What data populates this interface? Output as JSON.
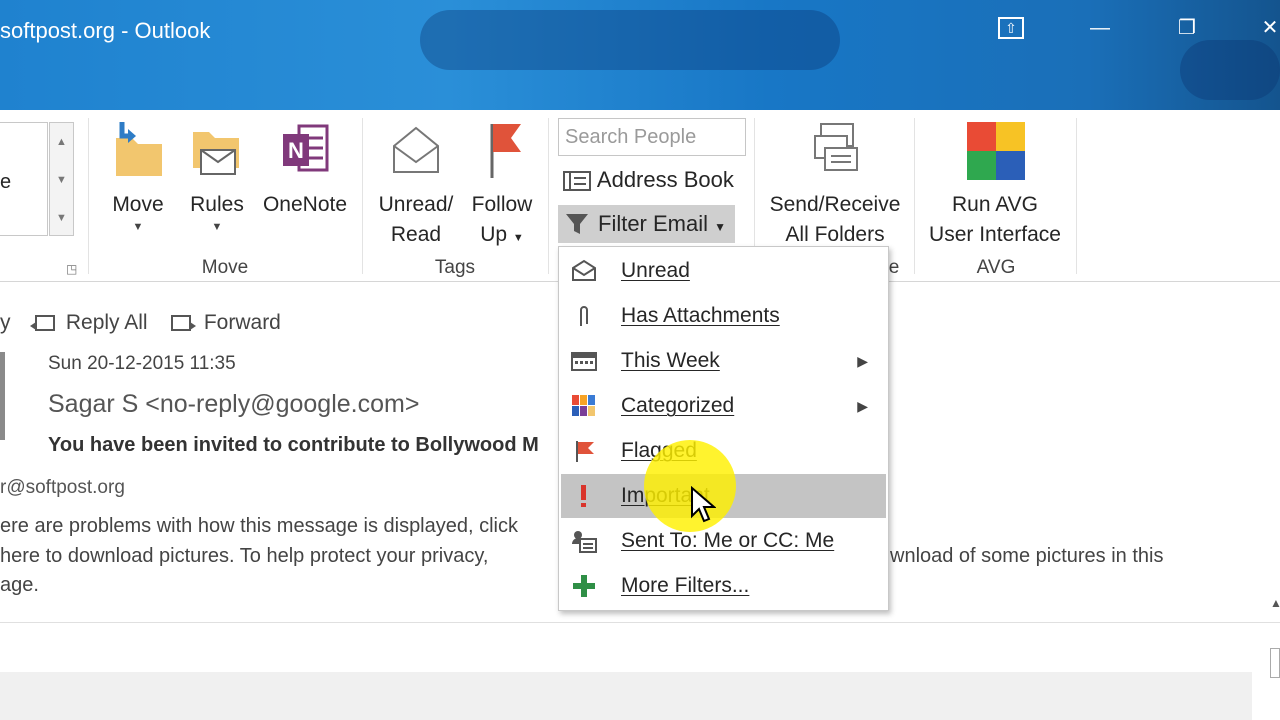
{
  "window": {
    "title": "softpost.org - Outlook",
    "controls": {
      "ribbon_display": "⇧",
      "minimize": "—",
      "restore": "❐",
      "close": "✕"
    }
  },
  "ribbon": {
    "move_group": {
      "label": "Move",
      "move": "Move",
      "rules": "Rules",
      "onenote": "OneNote"
    },
    "tags_group": {
      "label": "Tags",
      "unread_line1": "Unread/",
      "unread_line2": "Read",
      "follow_line1": "Follow",
      "follow_line2": "Up"
    },
    "find_group": {
      "search_placeholder": "Search People",
      "address_book": "Address Book",
      "filter_email": "Filter Email",
      "label_fragment": "e"
    },
    "send_receive_group": {
      "line1": "Send/Receive",
      "line2": "All Folders"
    },
    "avg_group": {
      "label": "AVG",
      "line1": "Run AVG",
      "line2": "User Interface"
    },
    "quick_steps_fragment": "e"
  },
  "reading_pane": {
    "actions": {
      "reply_fragment": "y",
      "reply_all": "Reply All",
      "forward": "Forward"
    },
    "date": "Sun 20-12-2015 11:35",
    "sender": "Sagar S <no-reply@google.com>",
    "subject": "You have been invited to contribute to Bollywood M",
    "to": "r@softpost.org",
    "info_line1": "ere are problems with how this message is displayed, click",
    "info_line2a": "here to download pictures. To help protect your privacy,",
    "info_line2b": "wnload of some pictures in this",
    "info_line3": "age."
  },
  "filter_menu": {
    "items": [
      {
        "label": "Unread",
        "icon": "envelope-icon",
        "submenu": false
      },
      {
        "label": "Has Attachments",
        "icon": "paperclip-icon",
        "submenu": false
      },
      {
        "label": "This Week",
        "icon": "calendar-week-icon",
        "submenu": true
      },
      {
        "label": "Categorized",
        "icon": "categories-icon",
        "submenu": true
      },
      {
        "label": "Flagged",
        "icon": "flag-icon",
        "submenu": false
      },
      {
        "label": "Important",
        "icon": "exclamation-icon",
        "submenu": false,
        "highlighted": true
      },
      {
        "label": "Sent To: Me or CC: Me",
        "icon": "person-card-icon",
        "submenu": false
      },
      {
        "label": "More Filters...",
        "icon": "plus-icon",
        "submenu": false
      }
    ]
  },
  "colors": {
    "titlebar": "#1f82cf",
    "flag": "#e0533a",
    "highlight": "#fff000",
    "onenote": "#80397b"
  }
}
